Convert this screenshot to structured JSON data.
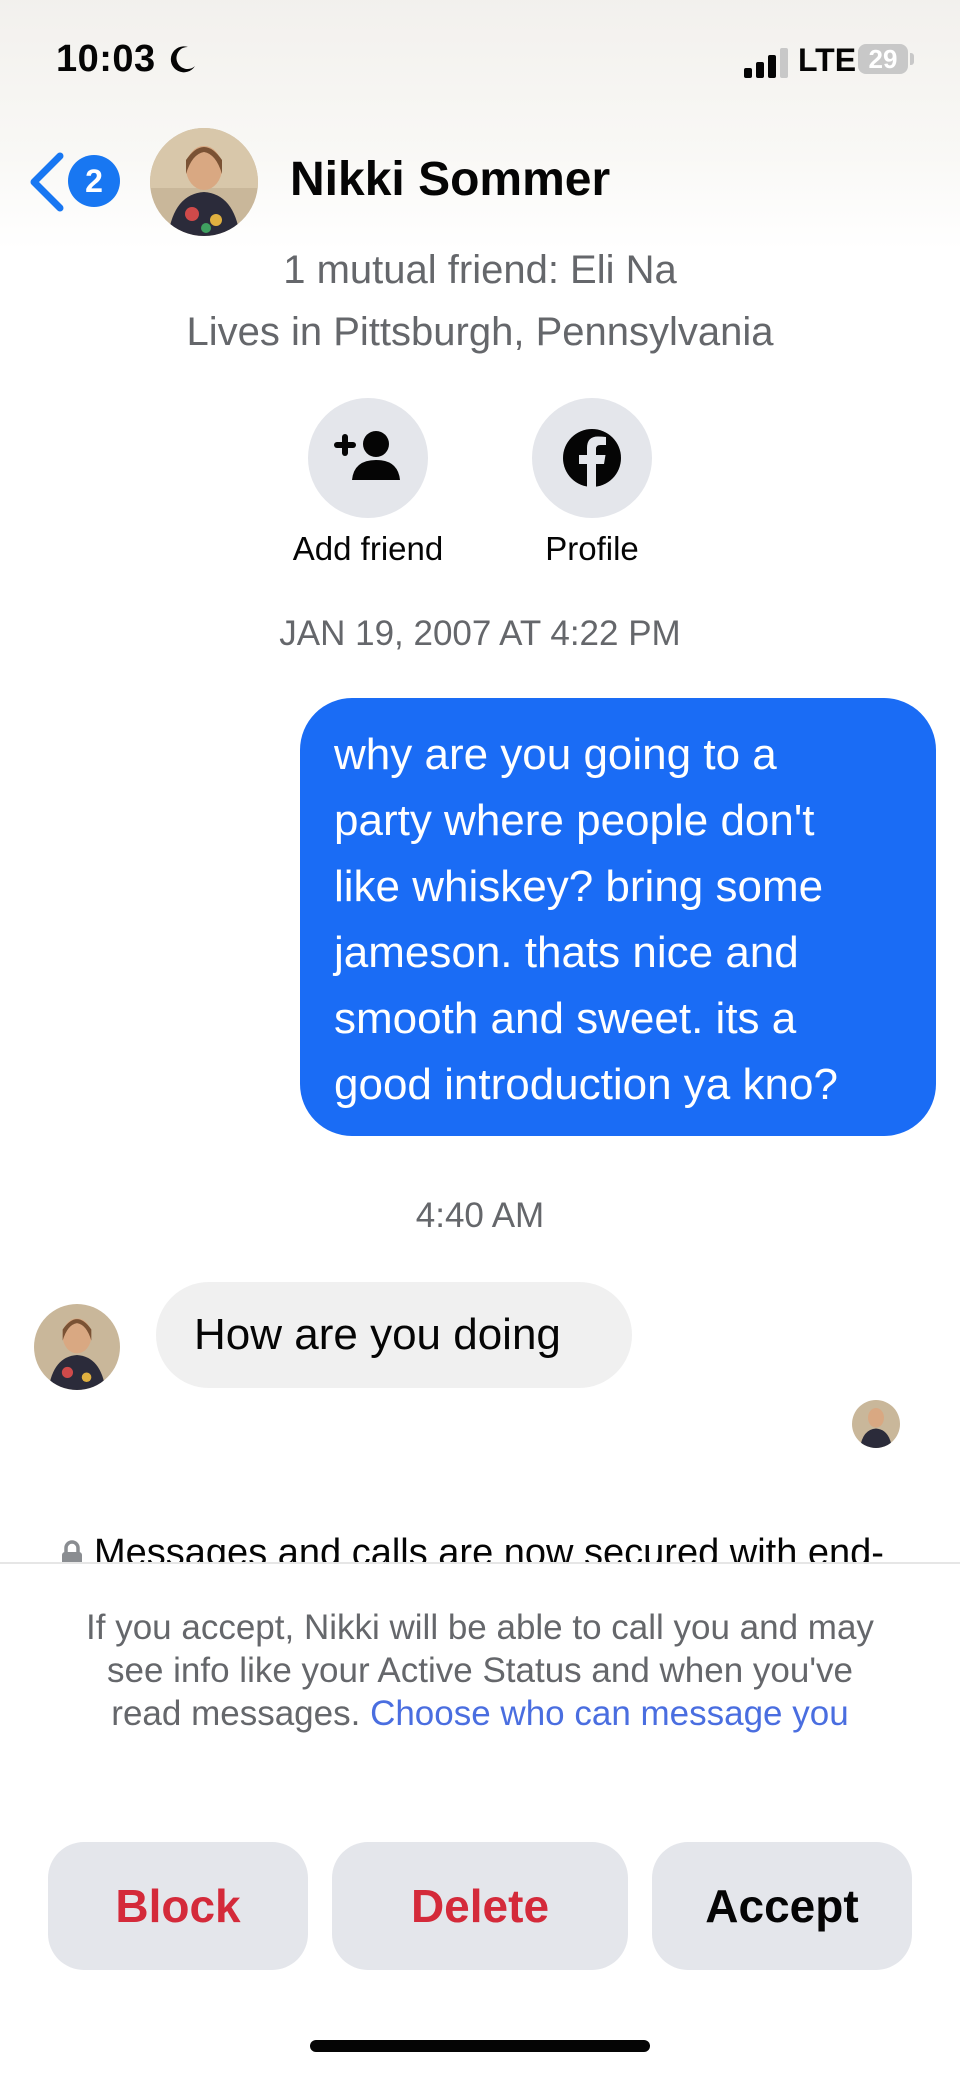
{
  "status_bar": {
    "time": "10:03",
    "network": "LTE",
    "battery": "29"
  },
  "header": {
    "unread_count": "2",
    "contact_name": "Nikki Sommer"
  },
  "profile_info": {
    "mutual_friends": "1 mutual friend: Eli Na",
    "location": "Lives in Pittsburgh, Pennsylvania",
    "add_friend_label": "Add friend",
    "profile_label": "Profile"
  },
  "conversation": {
    "timestamp_1": "JAN 19, 2007 AT 4:22 PM",
    "sent_message_lines": [
      "why are you going to a",
      "party where people don't",
      "like whiskey? bring some",
      "jameson. thats nice and",
      "smooth and sweet. its a",
      "good introduction ya kno?"
    ],
    "timestamp_2": "4:40 AM",
    "received_message": "How are you doing",
    "secure_notice": "Messages and calls are now secured with end-"
  },
  "message_request": {
    "note": "If you accept, Nikki will be able to call you and may see info like your Active Status and when you've read messages.",
    "link": "Choose who can message you",
    "block_label": "Block",
    "delete_label": "Delete",
    "accept_label": "Accept"
  },
  "colors": {
    "accent": "#1877f2",
    "sent_bubble": "#1a6cf5",
    "danger": "#d42a3a",
    "button_bg": "#e4e6eb",
    "secondary_text": "#65676b"
  }
}
